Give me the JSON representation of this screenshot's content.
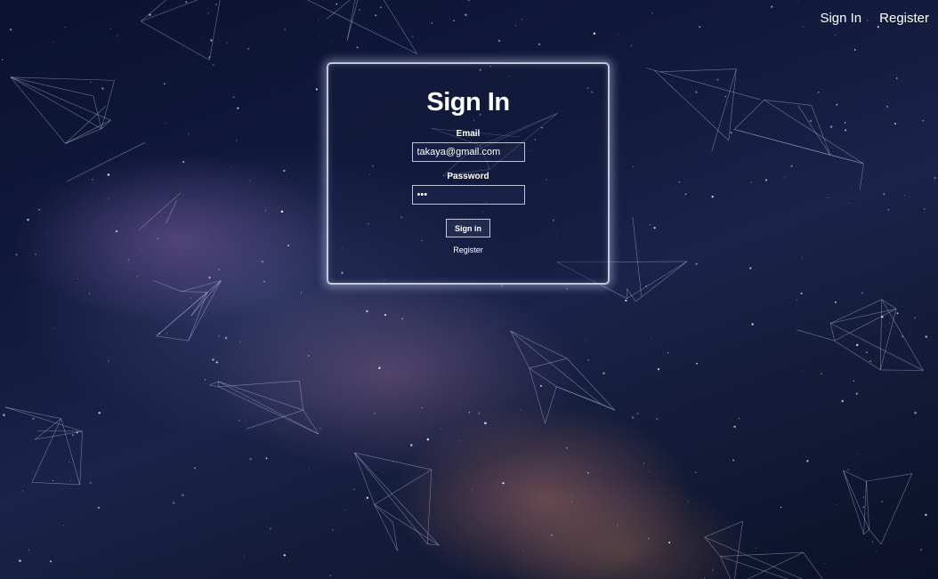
{
  "nav": {
    "sign_in": "Sign In",
    "register": "Register"
  },
  "form": {
    "title": "Sign In",
    "email_label": "Email",
    "email_value": "takaya@gmail.com",
    "password_label": "Password",
    "password_value": "•••",
    "submit_label": "Sign in",
    "register_link": "Register"
  },
  "colors": {
    "text": "#ffffff",
    "card_border": "#e1e6f5",
    "background": "#121a3d"
  }
}
